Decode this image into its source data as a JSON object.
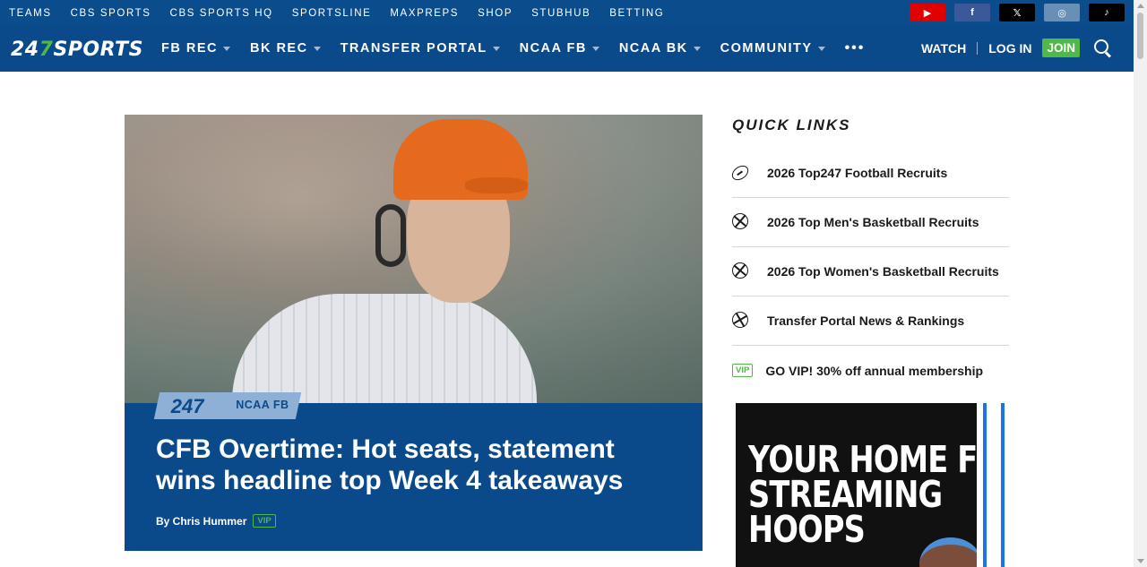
{
  "topbar": {
    "links": [
      "TEAMS",
      "CBS SPORTS",
      "CBS SPORTS HQ",
      "SPORTSLINE",
      "MAXPREPS",
      "SHOP",
      "STUBHUB",
      "BETTING"
    ],
    "social": [
      {
        "name": "youtube-icon",
        "glyph": "▶",
        "color": "#e00000"
      },
      {
        "name": "facebook-icon",
        "glyph": "f",
        "color": "#3b5998"
      },
      {
        "name": "x-icon",
        "glyph": "𝕏",
        "color": "#000000"
      },
      {
        "name": "instagram-icon",
        "glyph": "◎",
        "color": "#6a8fb6"
      },
      {
        "name": "tiktok-icon",
        "glyph": "♪",
        "color": "#000000"
      }
    ]
  },
  "nav": {
    "logo_prefix": "24",
    "logo_seven": "7",
    "logo_suffix": "SPORTS",
    "items": [
      "FB REC",
      "BK REC",
      "TRANSFER PORTAL",
      "NCAA FB",
      "NCAA BK",
      "COMMUNITY"
    ],
    "more": "•••",
    "watch": "WATCH",
    "login": "LOG IN",
    "join": "JOIN"
  },
  "hero": {
    "tag_logo": "247",
    "tag_section": "NCAA FB",
    "headline": "CFB Overtime: Hot seats, statement wins headline top Week 4 takeaways",
    "byline": "By Chris Hummer",
    "vip": "VIP"
  },
  "quick_links": {
    "title": "QUICK LINKS",
    "items": [
      {
        "icon": "football-icon",
        "label": "2026 Top247 Football Recruits"
      },
      {
        "icon": "basketball-icon",
        "label": "2026 Top Men's Basketball Recruits"
      },
      {
        "icon": "basketball-icon",
        "label": "2026 Top Women's Basketball Recruits"
      },
      {
        "icon": "transfer-icon",
        "label": "Transfer Portal News & Rankings"
      },
      {
        "icon": "vip-badge",
        "badge": "VIP",
        "label": "GO VIP! 30% off annual membership"
      }
    ]
  },
  "ad": {
    "lines": [
      "YOUR HOME FOR",
      "STREAMING",
      "HOOPS"
    ]
  },
  "colors": {
    "nav_blue": "#0a4a8a",
    "accent_green": "#4fb848"
  }
}
